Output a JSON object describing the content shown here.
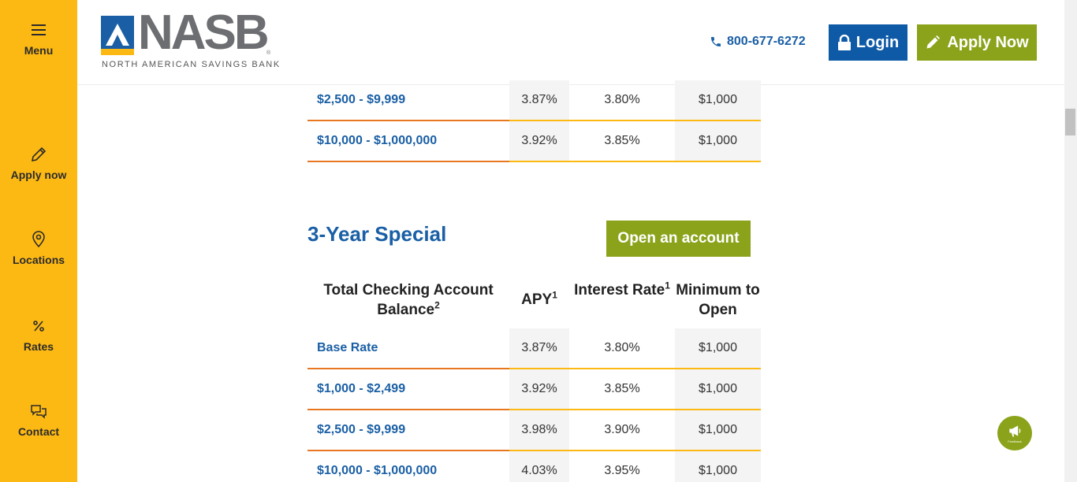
{
  "sidebar": {
    "menu": {
      "label": "Menu",
      "icon": "hamburger-icon"
    },
    "apply": {
      "label": "Apply now",
      "icon": "pencil-icon"
    },
    "locations": {
      "label": "Locations",
      "icon": "map-pin-icon"
    },
    "rates": {
      "label": "Rates",
      "icon": "percent-icon"
    },
    "contact": {
      "label": "Contact",
      "icon": "chat-bubbles-icon"
    },
    "color": "#fdb913"
  },
  "header": {
    "logo_word": "NASB",
    "logo_reg": "®",
    "logo_sub": "NORTH AMERICAN SAVINGS BANK",
    "phone": "800-677-6272",
    "login_label": "Login",
    "apply_label": "Apply Now",
    "colors": {
      "login": "#0e5aa7",
      "apply": "#8aa31a",
      "link": "#1a5fa5"
    }
  },
  "top_table": {
    "rows": [
      {
        "balance": "$2,500 - $9,999",
        "apy": "3.87%",
        "rate": "3.80%",
        "min": "$1,000"
      },
      {
        "balance": "$10,000 - $1,000,000",
        "apy": "3.92%",
        "rate": "3.85%",
        "min": "$1,000"
      }
    ]
  },
  "special": {
    "title": "3-Year Special",
    "open_label": "Open an account",
    "headers": {
      "balance": "Total Checking Account Balance",
      "balance_sup": "2",
      "apy": "APY",
      "apy_sup": "1",
      "rate": "Interest Rate",
      "rate_sup": "1",
      "min": "Minimum to Open"
    },
    "rows": [
      {
        "balance": "Base Rate",
        "apy": "3.87%",
        "rate": "3.80%",
        "min": "$1,000"
      },
      {
        "balance": "$1,000 - $2,499",
        "apy": "3.92%",
        "rate": "3.85%",
        "min": "$1,000"
      },
      {
        "balance": "$2,500 - $9,999",
        "apy": "3.98%",
        "rate": "3.90%",
        "min": "$1,000"
      },
      {
        "balance": "$10,000 - $1,000,000",
        "apy": "4.03%",
        "rate": "3.95%",
        "min": "$1,000"
      }
    ]
  },
  "feedback": {
    "label": "Feedback",
    "icon": "megaphone-icon"
  }
}
